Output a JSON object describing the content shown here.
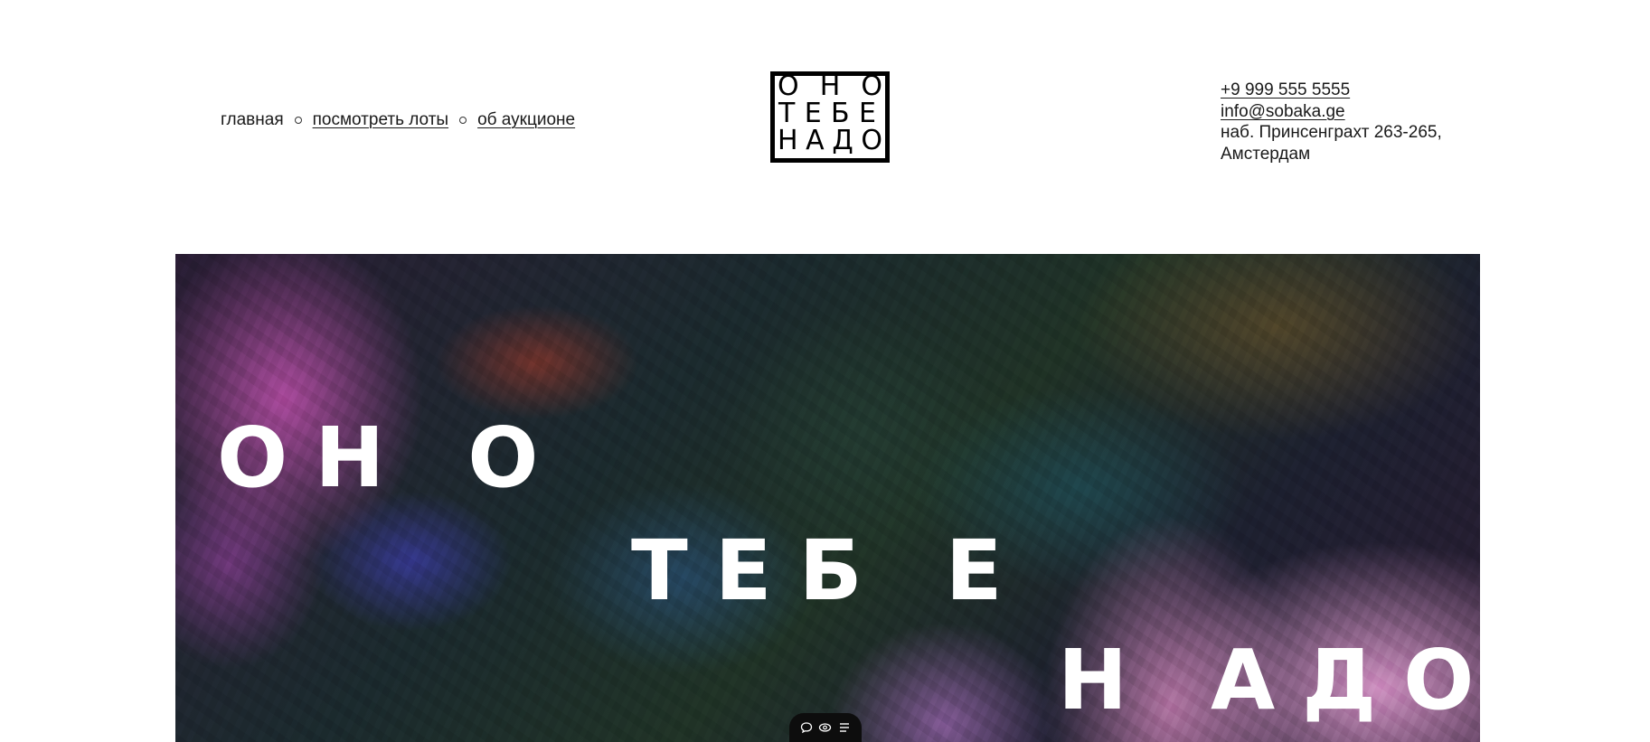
{
  "header": {
    "nav": {
      "home": "главная",
      "lots": "посмотреть лоты",
      "about": "об аукционе"
    },
    "logo": {
      "row1": [
        "О",
        "Н",
        "О"
      ],
      "row2": [
        "Т",
        "Е",
        "Б",
        "Е"
      ],
      "row3": [
        "Н",
        "А",
        "Д",
        "О"
      ]
    },
    "contacts": {
      "phone": "+9 999 555 5555",
      "email": "info@sobaka.ge",
      "address": "наб. Принсенграхт 263-265, Амстердам"
    }
  },
  "hero": {
    "line1": "ОН О",
    "line2": "ТЕБ Е",
    "line3": "Н АДО"
  },
  "toolbar": {
    "icons": [
      "comment-icon",
      "eye-icon",
      "menu-icon"
    ]
  }
}
